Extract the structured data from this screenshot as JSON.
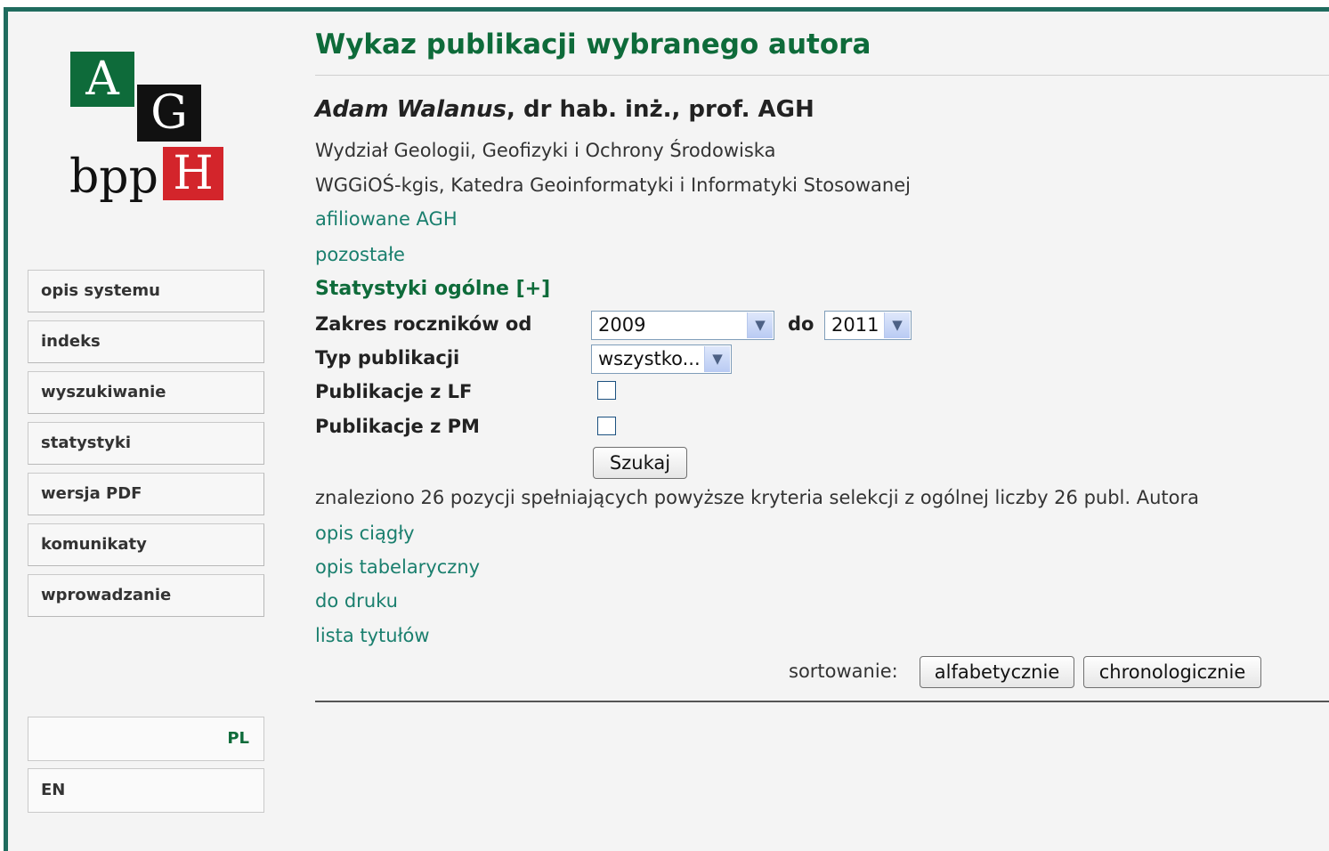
{
  "logo": {
    "a": "A",
    "g": "G",
    "h": "H",
    "bpp": "bpp"
  },
  "menu": [
    {
      "label": "opis systemu"
    },
    {
      "label": "indeks"
    },
    {
      "label": "wyszukiwanie"
    },
    {
      "label": "statystyki"
    },
    {
      "label": "wersja PDF"
    },
    {
      "label": "komunikaty"
    },
    {
      "label": "wprowadzanie"
    }
  ],
  "lang": {
    "pl": "PL",
    "en": "EN"
  },
  "page": {
    "title": "Wykaz publikacji wybranego autora",
    "author_name": "Adam Walanus",
    "author_title": ", dr hab. inż., prof. AGH",
    "faculty": "Wydział Geologii, Geofizyki i Ochrony Środowiska",
    "department": "WGGiOŚ-kgis, Katedra Geoinformatyki i Informatyki Stosowanej",
    "link_affiliated": "afiliowane AGH",
    "link_other": "pozostałe",
    "stats_toggle": "Statystyki ogólne [+]"
  },
  "form": {
    "years_label": "Zakres roczników od",
    "year_from": "2009",
    "year_to_label": "do",
    "year_to": "2011",
    "type_label": "Typ publikacji",
    "type_value": "wszystko...",
    "lf_label": "Publikacje z LF",
    "lf_checked": false,
    "pm_label": "Publikacje z PM",
    "pm_checked": false,
    "search_button": "Szukaj"
  },
  "results": {
    "summary": "znaleziono 26 pozycji spełniających powyższe kryteria selekcji z ogólnej liczby 26 publ. Autora",
    "links": [
      "opis ciągły",
      "opis tabelaryczny",
      "do druku",
      "lista tytułów"
    ],
    "sort_label": "sortowanie:",
    "sort_alpha": "alfabetycznie",
    "sort_chrono": "chronologicznie"
  },
  "colors": {
    "brand_green": "#0e6b3a",
    "link_teal": "#1a7f6e",
    "frame": "#1f6b5e",
    "logo_red": "#d3252b"
  }
}
